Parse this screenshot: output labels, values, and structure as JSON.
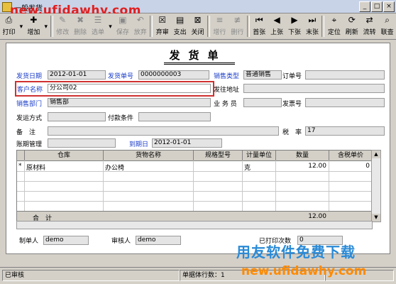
{
  "window": {
    "title": "一般发货",
    "watermark_top": "new.ufidawhy.com"
  },
  "toolbar": [
    {
      "label": "打印",
      "icon": "printer-icon",
      "glyph": "⎙",
      "enabled": true
    },
    {
      "label": "增加",
      "icon": "add-icon",
      "glyph": "✚",
      "enabled": true
    },
    {
      "label": "修改",
      "icon": "edit-icon",
      "glyph": "✎",
      "enabled": false
    },
    {
      "label": "删除",
      "icon": "delete-icon",
      "glyph": "✖",
      "enabled": false
    },
    {
      "label": "选单",
      "icon": "select-icon",
      "glyph": "☰",
      "enabled": false
    },
    {
      "label": "保存",
      "icon": "save-icon",
      "glyph": "▣",
      "enabled": false
    },
    {
      "label": "放弃",
      "icon": "discard-icon",
      "glyph": "↶",
      "enabled": false
    },
    {
      "label": "弃审",
      "icon": "unapprove-icon",
      "glyph": "☒",
      "enabled": true
    },
    {
      "label": "支出",
      "icon": "expense-icon",
      "glyph": "▤",
      "enabled": true
    },
    {
      "label": "关闭",
      "icon": "close-doc-icon",
      "glyph": "⊠",
      "enabled": true
    },
    {
      "label": "增行",
      "icon": "add-row-icon",
      "glyph": "≡",
      "enabled": false
    },
    {
      "label": "删行",
      "icon": "delete-row-icon",
      "glyph": "≢",
      "enabled": false
    },
    {
      "label": "首张",
      "icon": "first-icon",
      "glyph": "⏮",
      "enabled": true
    },
    {
      "label": "上张",
      "icon": "prev-icon",
      "glyph": "◀",
      "enabled": true
    },
    {
      "label": "下张",
      "icon": "next-icon",
      "glyph": "▶",
      "enabled": true
    },
    {
      "label": "末张",
      "icon": "last-icon",
      "glyph": "⏭",
      "enabled": true
    },
    {
      "label": "定位",
      "icon": "locate-icon",
      "glyph": "⌖",
      "enabled": true
    },
    {
      "label": "刷新",
      "icon": "refresh-icon",
      "glyph": "⟳",
      "enabled": true
    },
    {
      "label": "流转",
      "icon": "flow-icon",
      "glyph": "⇄",
      "enabled": true
    },
    {
      "label": "联查",
      "icon": "query-icon",
      "glyph": "⌕",
      "enabled": true
    }
  ],
  "form": {
    "title": "发货单",
    "fields": {
      "ship_date": {
        "label": "发货日期",
        "value": "2012-01-01"
      },
      "ship_no": {
        "label": "发货单号",
        "value": "0000000003"
      },
      "sale_type": {
        "label": "销售类型",
        "value": "普通销售"
      },
      "order_no": {
        "label": "订单号",
        "value": ""
      },
      "customer": {
        "label": "客户名称",
        "value": "分公司02"
      },
      "ship_addr": {
        "label": "发往地址",
        "value": ""
      },
      "dept": {
        "label": "销售部门",
        "value": "销售部"
      },
      "staff": {
        "label": "业 务 员",
        "value": ""
      },
      "invoice_no": {
        "label": "发票号",
        "value": ""
      },
      "ship_method": {
        "label": "发运方式",
        "value": ""
      },
      "pay_terms": {
        "label": "付款条件",
        "value": ""
      },
      "remark": {
        "label": "备　注",
        "value": ""
      },
      "tax_rate": {
        "label": "税　率",
        "value": "17"
      },
      "period": {
        "label": "账期管理",
        "value": ""
      },
      "due_date": {
        "label": "到期日",
        "value": "2012-01-01"
      }
    },
    "table": {
      "columns": [
        "仓库",
        "货物名称",
        "规格型号",
        "计量单位",
        "数量",
        "含税单价"
      ],
      "rows": [
        {
          "marker": "*",
          "warehouse": "原材料",
          "item": "办公椅",
          "spec": "",
          "unit": "克",
          "qty": "12.00",
          "price": "0"
        }
      ],
      "total": {
        "label": "合　计",
        "qty": "12.00"
      }
    },
    "footer": {
      "maker_label": "制单人",
      "maker": "demo",
      "auditor_label": "审核人",
      "auditor": "demo",
      "print_label": "已打印次数",
      "print_count": "0"
    }
  },
  "status": {
    "state": "已审核",
    "rows_label": "单据体行数：1"
  },
  "watermark": {
    "brand": "用友软件免费下载",
    "url": "new.ufidawhy.com"
  }
}
